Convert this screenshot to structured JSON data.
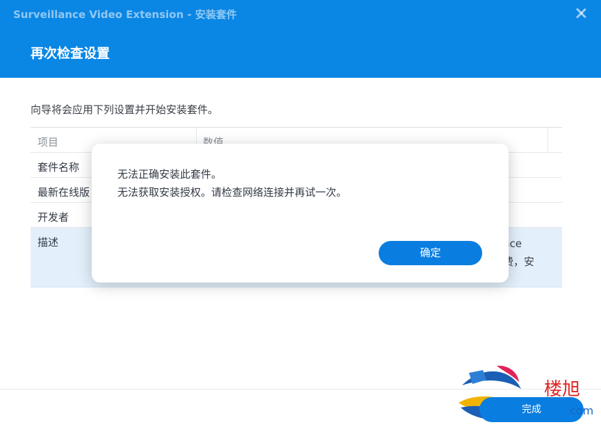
{
  "window": {
    "title": "Surveillance Video Extension - 安装套件",
    "step_title": "再次检查设置"
  },
  "wizard": {
    "intro": "向导将会应用下列设置并开始安装套件。",
    "table": {
      "headers": [
        "项目",
        "数值"
      ],
      "rows": [
        {
          "item": "套件名称",
          "value": ""
        },
        {
          "item": "最新在线版",
          "value": ""
        },
        {
          "item": "开发者",
          "value": ""
        },
        {
          "item": "描述",
          "value": "nce\n费，安"
        }
      ]
    },
    "finish_label": "完成"
  },
  "dialog": {
    "line1": "无法正确安装此套件。",
    "line2": "无法获取安装授权。请检查网络连接并再试一次。",
    "ok_label": "确定"
  },
  "watermark": {
    "text": "楼旭",
    "suffix": ".com"
  },
  "colors": {
    "header": "#0a86e4",
    "button": "#0a7ee0",
    "selected_row": "#e3f0fc"
  }
}
